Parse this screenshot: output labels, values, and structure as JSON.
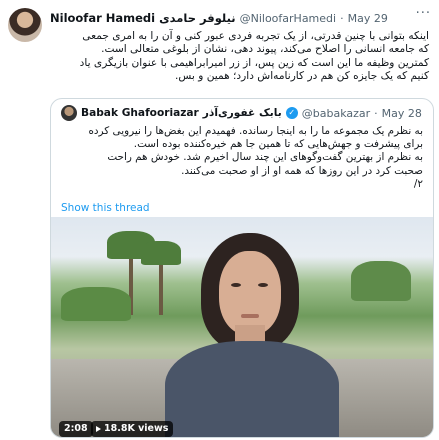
{
  "tweet": {
    "name": "Niloofar Hamedi",
    "name_fa": "نیلوفر حامدی",
    "handle": "@NiloofarHamedi",
    "date": "May 29",
    "text": "اینکه بتوانی با چنین قدرتی، از یک تجربه فردی عبور کنی و آن را به امری جمعی\nکه جامعه انسانی را اصلاح می‌کند، پیوند دهی، نشان از بلوغی متعالی است.\nکمترین وظیفه ما این است که زین پس، از زر امیرابراهیمی با عنوان بازیگری یاد\nکنیم که یک جایزه کن هم در کارنامه‌اش دارد؛ همین و بس."
  },
  "quote": {
    "name": "Babak Ghafooriazar",
    "name_fa": "بابک غفوری‌آذر",
    "handle": "@babakazar",
    "date": "May 28",
    "text": "به نظرم یک مجموعه ما را به اینجا رسانده. فهمیدم این بغض‌ها را نیرویی کرده\nبرای پیشرفت و جهش‌هایی که تا همین جا هم خیره‌کننده بوده است.\nبه نظرم از بهترین گفت‌وگوهای این چند سال اخیرم شد. خودش هم راحت\nصحبت کرد در این روزها که همه او از او صحبت می‌کنند.\n۲/",
    "show_thread": "Show this thread"
  },
  "video": {
    "duration": "2:08",
    "views": "18.8K views"
  },
  "icons": {
    "more": "more-icon",
    "verified": "verified-badge-icon",
    "play": "play-icon"
  },
  "colors": {
    "accent": "#1d9bf0",
    "muted": "#536471",
    "border": "#cfd9de"
  }
}
